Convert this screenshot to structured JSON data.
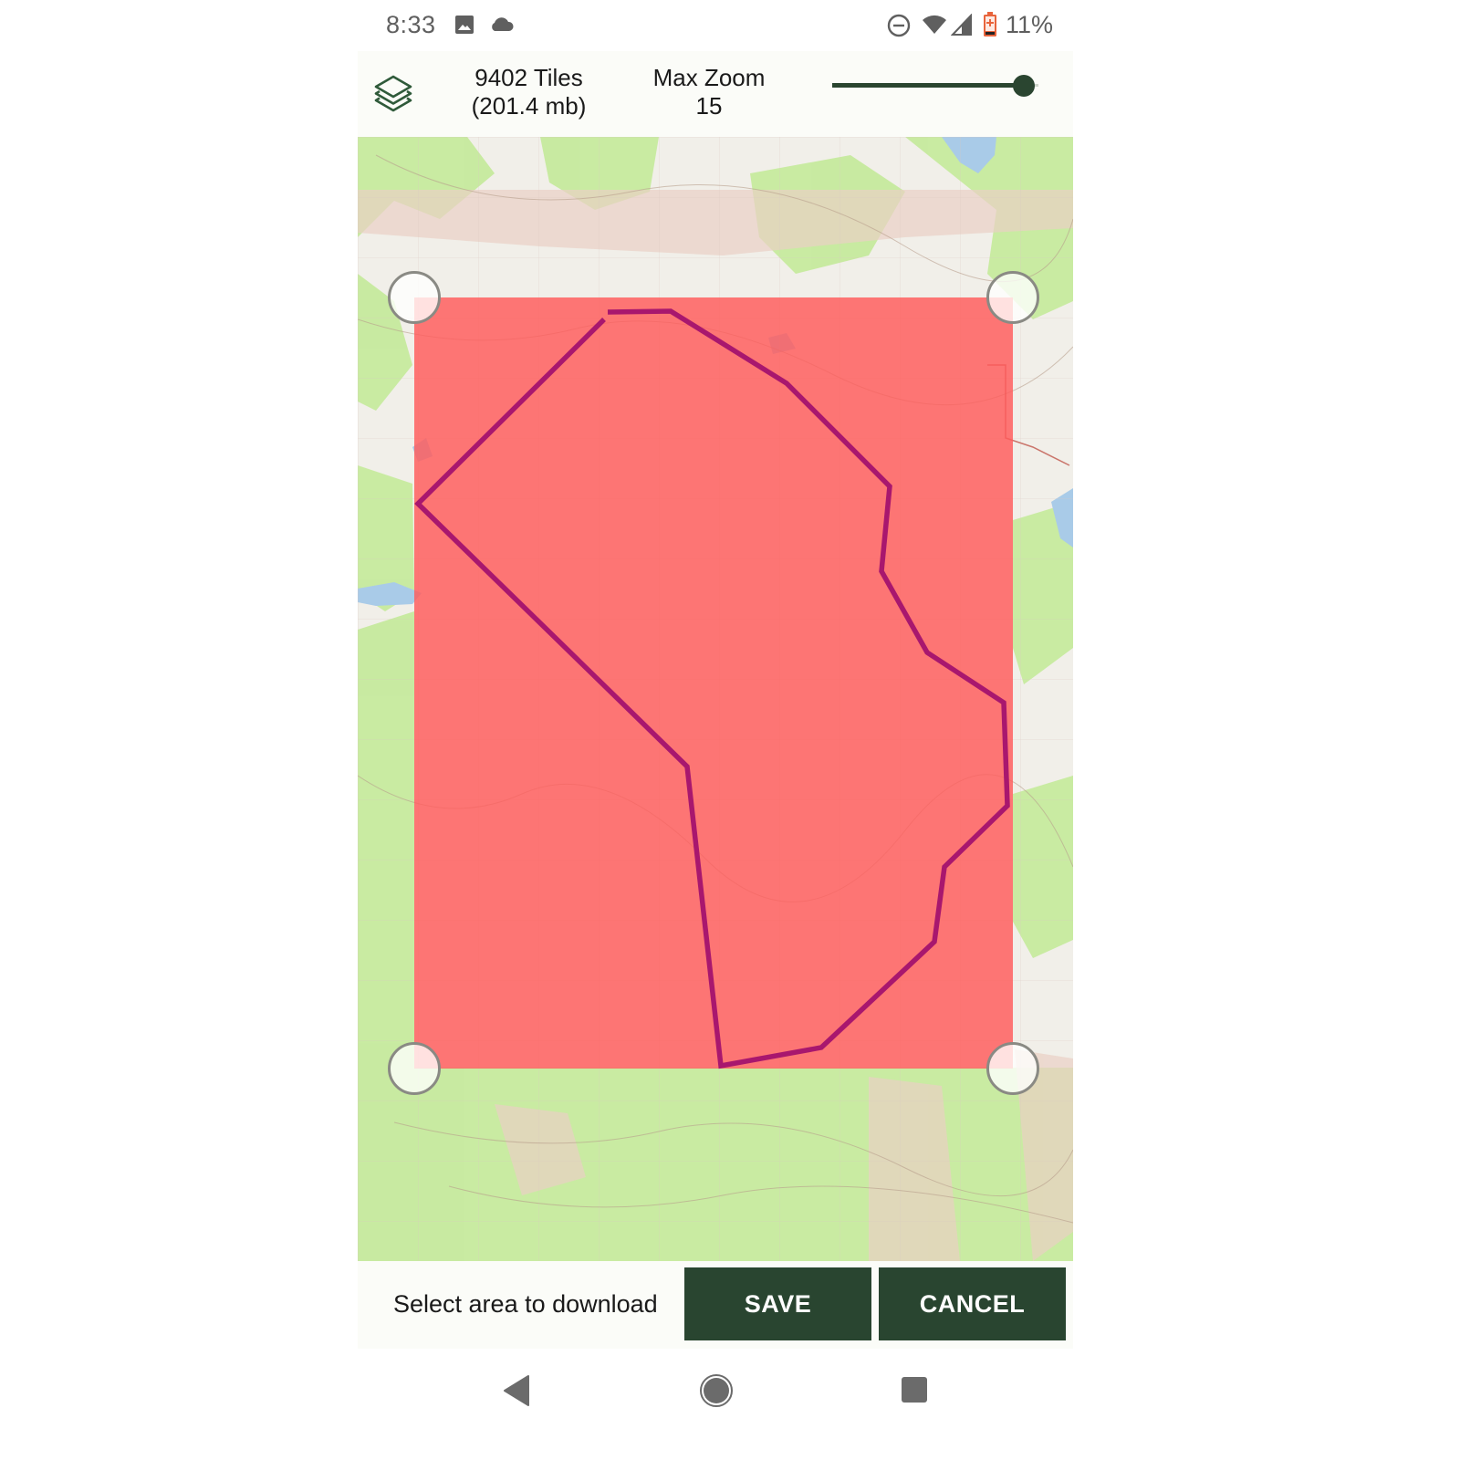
{
  "status_bar": {
    "time": "8:33",
    "left_icons": [
      "image-icon",
      "cloud-icon"
    ],
    "right_icons": [
      "do-not-disturb-icon",
      "wifi-icon",
      "cell-signal-icon",
      "battery-low-icon"
    ],
    "battery_percent": "11%",
    "battery_color": "#e8643c"
  },
  "header": {
    "layers_icon": "layers-icon",
    "tiles_line1": "9402 Tiles",
    "tiles_line2": "(201.4 mb)",
    "zoom_label": "Max Zoom",
    "zoom_value": "15",
    "slider_fraction": 0.93,
    "accent_color": "#2a4530"
  },
  "map": {
    "selection_fill": "#ff5a5a",
    "polygon_stroke": "#a8176e",
    "handles": [
      "top-left",
      "top-right",
      "bottom-left",
      "bottom-right"
    ]
  },
  "bottom_bar": {
    "hint": "Select area to download",
    "save_label": "SAVE",
    "cancel_label": "CANCEL"
  },
  "nav_bar": {
    "buttons": [
      "back-icon",
      "home-icon",
      "recents-icon"
    ]
  }
}
